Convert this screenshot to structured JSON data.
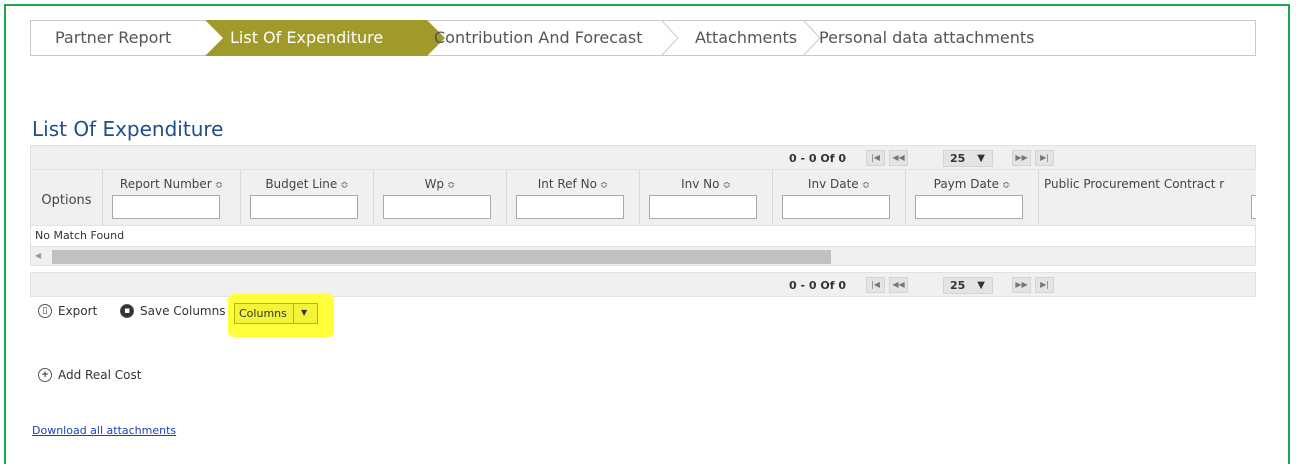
{
  "tabs": [
    {
      "label": "Partner Report",
      "active": false
    },
    {
      "label": "List Of Expenditure",
      "active": true
    },
    {
      "label": "Contribution And Forecast",
      "active": false
    },
    {
      "label": "Attachments",
      "active": false
    },
    {
      "label": "Personal data attachments",
      "active": false
    }
  ],
  "colors": {
    "active_tab": "#a09a2a",
    "title": "#1f4e8c",
    "frame": "#1aa84a",
    "highlight": "#ffff3a"
  },
  "title": "List Of Expenditure",
  "grid": {
    "pager": {
      "info": "0 - 0 Of 0",
      "page_size": "25",
      "page_size_caret": "▼",
      "first_icon": "⏮",
      "prev_icon": "◀◀",
      "next_icon": "▶▶",
      "last_icon": "⏭"
    },
    "columns": [
      {
        "label": "Options",
        "filter": false
      },
      {
        "label": "Report Number",
        "filter": true
      },
      {
        "label": "Budget Line",
        "filter": true
      },
      {
        "label": "Wp",
        "filter": true
      },
      {
        "label": "Int Ref No",
        "filter": true
      },
      {
        "label": "Inv No",
        "filter": true
      },
      {
        "label": "Inv Date",
        "filter": true
      },
      {
        "label": "Paym Date",
        "filter": true
      },
      {
        "label": "Public Procurement Contract r",
        "filter": true
      }
    ],
    "sort_icon": "≎",
    "empty_message": "No Match Found"
  },
  "toolbar": {
    "export_label": "Export",
    "save_columns_label": "Save Columns",
    "columns_label": "Columns"
  },
  "add_real_cost_label": "Add Real Cost",
  "download_link": "Download all attachments"
}
